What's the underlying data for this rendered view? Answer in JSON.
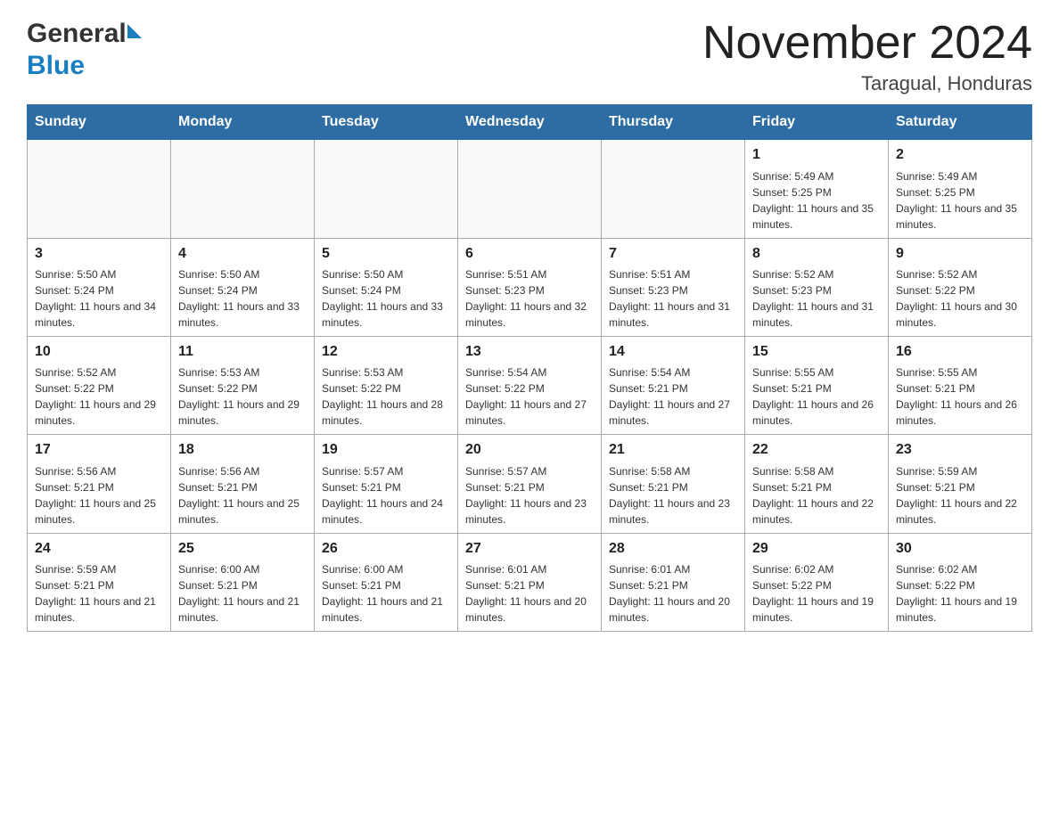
{
  "header": {
    "logo_general": "General",
    "logo_blue": "Blue",
    "month_title": "November 2024",
    "location": "Taragual, Honduras"
  },
  "days_of_week": [
    "Sunday",
    "Monday",
    "Tuesday",
    "Wednesday",
    "Thursday",
    "Friday",
    "Saturday"
  ],
  "weeks": [
    [
      {
        "day": "",
        "info": ""
      },
      {
        "day": "",
        "info": ""
      },
      {
        "day": "",
        "info": ""
      },
      {
        "day": "",
        "info": ""
      },
      {
        "day": "",
        "info": ""
      },
      {
        "day": "1",
        "info": "Sunrise: 5:49 AM\nSunset: 5:25 PM\nDaylight: 11 hours and 35 minutes."
      },
      {
        "day": "2",
        "info": "Sunrise: 5:49 AM\nSunset: 5:25 PM\nDaylight: 11 hours and 35 minutes."
      }
    ],
    [
      {
        "day": "3",
        "info": "Sunrise: 5:50 AM\nSunset: 5:24 PM\nDaylight: 11 hours and 34 minutes."
      },
      {
        "day": "4",
        "info": "Sunrise: 5:50 AM\nSunset: 5:24 PM\nDaylight: 11 hours and 33 minutes."
      },
      {
        "day": "5",
        "info": "Sunrise: 5:50 AM\nSunset: 5:24 PM\nDaylight: 11 hours and 33 minutes."
      },
      {
        "day": "6",
        "info": "Sunrise: 5:51 AM\nSunset: 5:23 PM\nDaylight: 11 hours and 32 minutes."
      },
      {
        "day": "7",
        "info": "Sunrise: 5:51 AM\nSunset: 5:23 PM\nDaylight: 11 hours and 31 minutes."
      },
      {
        "day": "8",
        "info": "Sunrise: 5:52 AM\nSunset: 5:23 PM\nDaylight: 11 hours and 31 minutes."
      },
      {
        "day": "9",
        "info": "Sunrise: 5:52 AM\nSunset: 5:22 PM\nDaylight: 11 hours and 30 minutes."
      }
    ],
    [
      {
        "day": "10",
        "info": "Sunrise: 5:52 AM\nSunset: 5:22 PM\nDaylight: 11 hours and 29 minutes."
      },
      {
        "day": "11",
        "info": "Sunrise: 5:53 AM\nSunset: 5:22 PM\nDaylight: 11 hours and 29 minutes."
      },
      {
        "day": "12",
        "info": "Sunrise: 5:53 AM\nSunset: 5:22 PM\nDaylight: 11 hours and 28 minutes."
      },
      {
        "day": "13",
        "info": "Sunrise: 5:54 AM\nSunset: 5:22 PM\nDaylight: 11 hours and 27 minutes."
      },
      {
        "day": "14",
        "info": "Sunrise: 5:54 AM\nSunset: 5:21 PM\nDaylight: 11 hours and 27 minutes."
      },
      {
        "day": "15",
        "info": "Sunrise: 5:55 AM\nSunset: 5:21 PM\nDaylight: 11 hours and 26 minutes."
      },
      {
        "day": "16",
        "info": "Sunrise: 5:55 AM\nSunset: 5:21 PM\nDaylight: 11 hours and 26 minutes."
      }
    ],
    [
      {
        "day": "17",
        "info": "Sunrise: 5:56 AM\nSunset: 5:21 PM\nDaylight: 11 hours and 25 minutes."
      },
      {
        "day": "18",
        "info": "Sunrise: 5:56 AM\nSunset: 5:21 PM\nDaylight: 11 hours and 25 minutes."
      },
      {
        "day": "19",
        "info": "Sunrise: 5:57 AM\nSunset: 5:21 PM\nDaylight: 11 hours and 24 minutes."
      },
      {
        "day": "20",
        "info": "Sunrise: 5:57 AM\nSunset: 5:21 PM\nDaylight: 11 hours and 23 minutes."
      },
      {
        "day": "21",
        "info": "Sunrise: 5:58 AM\nSunset: 5:21 PM\nDaylight: 11 hours and 23 minutes."
      },
      {
        "day": "22",
        "info": "Sunrise: 5:58 AM\nSunset: 5:21 PM\nDaylight: 11 hours and 22 minutes."
      },
      {
        "day": "23",
        "info": "Sunrise: 5:59 AM\nSunset: 5:21 PM\nDaylight: 11 hours and 22 minutes."
      }
    ],
    [
      {
        "day": "24",
        "info": "Sunrise: 5:59 AM\nSunset: 5:21 PM\nDaylight: 11 hours and 21 minutes."
      },
      {
        "day": "25",
        "info": "Sunrise: 6:00 AM\nSunset: 5:21 PM\nDaylight: 11 hours and 21 minutes."
      },
      {
        "day": "26",
        "info": "Sunrise: 6:00 AM\nSunset: 5:21 PM\nDaylight: 11 hours and 21 minutes."
      },
      {
        "day": "27",
        "info": "Sunrise: 6:01 AM\nSunset: 5:21 PM\nDaylight: 11 hours and 20 minutes."
      },
      {
        "day": "28",
        "info": "Sunrise: 6:01 AM\nSunset: 5:21 PM\nDaylight: 11 hours and 20 minutes."
      },
      {
        "day": "29",
        "info": "Sunrise: 6:02 AM\nSunset: 5:22 PM\nDaylight: 11 hours and 19 minutes."
      },
      {
        "day": "30",
        "info": "Sunrise: 6:02 AM\nSunset: 5:22 PM\nDaylight: 11 hours and 19 minutes."
      }
    ]
  ]
}
